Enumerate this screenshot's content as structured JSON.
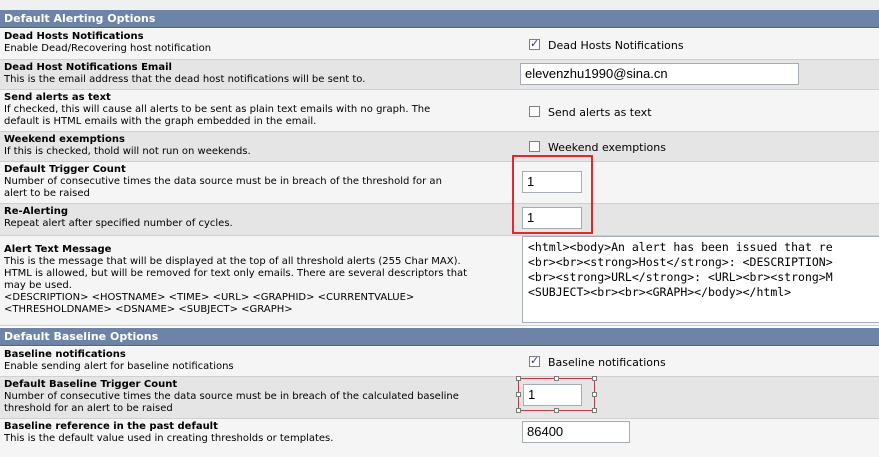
{
  "sections": {
    "alerting": "Default Alerting Options",
    "baseline": "Default Baseline Options"
  },
  "rows": {
    "dead_hosts": {
      "title": "Dead Hosts Notifications",
      "desc": "Enable Dead/Recovering host notification",
      "checkbox_label": "Dead Hosts Notifications",
      "checked": true
    },
    "dead_email": {
      "title": "Dead Host Notifications Email",
      "desc": "This is the email address that the dead host notifications will be sent to.",
      "value": "elevenzhu1990@sina.cn"
    },
    "send_text": {
      "title": "Send alerts as text",
      "desc1": "If checked, this will cause all alerts to be sent as plain text emails with no graph. The",
      "desc2": "default is HTML emails with the graph embedded in the email.",
      "checkbox_label": "Send alerts as text",
      "checked": false
    },
    "weekend": {
      "title": "Weekend exemptions",
      "desc": "If this is checked, thold will not run on weekends.",
      "checkbox_label": "Weekend exemptions",
      "checked": false
    },
    "trigger": {
      "title": "Default Trigger Count",
      "desc1": "Number of consecutive times the data source must be in breach of the threshold for an",
      "desc2": "alert to be raised",
      "value": "1"
    },
    "realert": {
      "title": "Re-Alerting",
      "desc": "Repeat alert after specified number of cycles.",
      "value": "1"
    },
    "alert_text": {
      "title": "Alert Text Message",
      "desc1": "This is the message that will be displayed at the top of all threshold alerts (255 Char MAX).",
      "desc2": "HTML is allowed, but will be removed for text only emails. There are several descriptors that",
      "desc3": "may be used.",
      "desc4": "<DESCRIPTION> <HOSTNAME> <TIME> <URL> <GRAPHID> <CURRENTVALUE>",
      "desc5": "<THRESHOLDNAME> <DSNAME> <SUBJECT> <GRAPH>",
      "line1": "<html><body>An alert has been issued that re",
      "line2": "<br><br><strong>Host</strong>: <DESCRIPTION>",
      "line3": "<br><strong>URL</strong>: <URL><br><strong>M",
      "line4": "<SUBJECT><br><br><GRAPH></body></html>"
    },
    "baseline_notif": {
      "title": "Baseline notifications",
      "desc": "Enable sending alert for baseline notifications",
      "checkbox_label": "Baseline notifications",
      "checked": true
    },
    "baseline_trigger": {
      "title": "Default Baseline Trigger Count",
      "desc1": "Number of consecutive times the data source must be in breach of the calculated baseline",
      "desc2": "threshold for an alert to be raised",
      "value": "1"
    },
    "baseline_ref": {
      "title": "Baseline reference in the past default",
      "desc": "This is the default value used in creating thresholds or templates.",
      "value": "86400"
    }
  }
}
